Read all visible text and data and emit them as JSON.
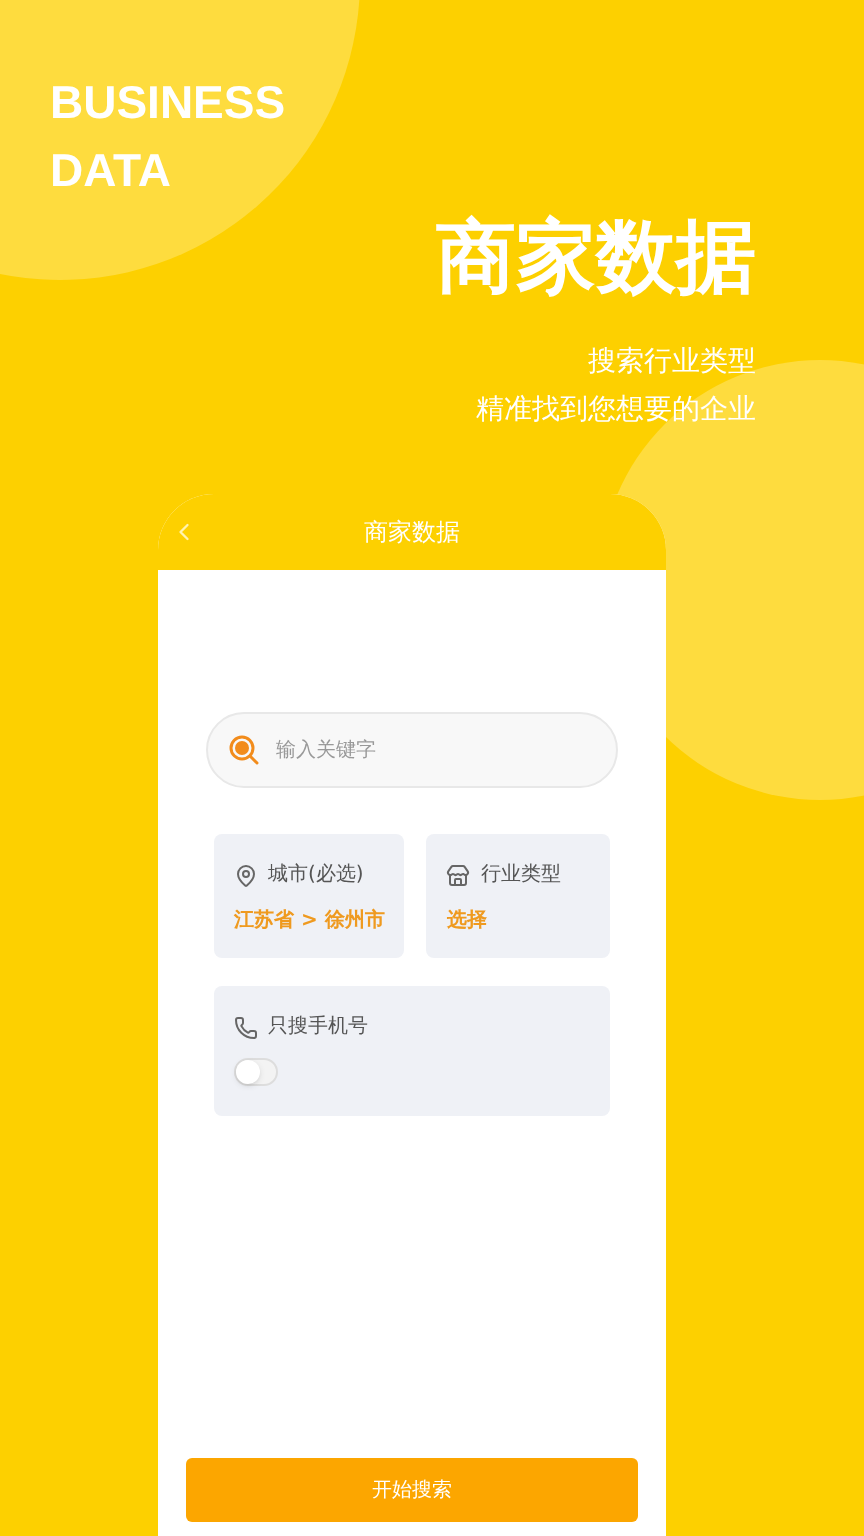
{
  "hero": {
    "english_title": "BUSINESS\nDATA",
    "title": "商家数据",
    "subtitle_lines": [
      "搜索行业类型",
      "精准找到您想要的企业"
    ]
  },
  "phone": {
    "header_title": "商家数据",
    "search": {
      "placeholder": "输入关键字"
    },
    "filters": [
      {
        "kind": "location",
        "label": "城市(必选)",
        "value": "江苏省 > 徐州市"
      },
      {
        "kind": "industry",
        "label": "行业类型",
        "value": "选择"
      }
    ],
    "phone_only": {
      "label": "只搜手机号",
      "on": false
    },
    "submit": "开始搜索"
  }
}
